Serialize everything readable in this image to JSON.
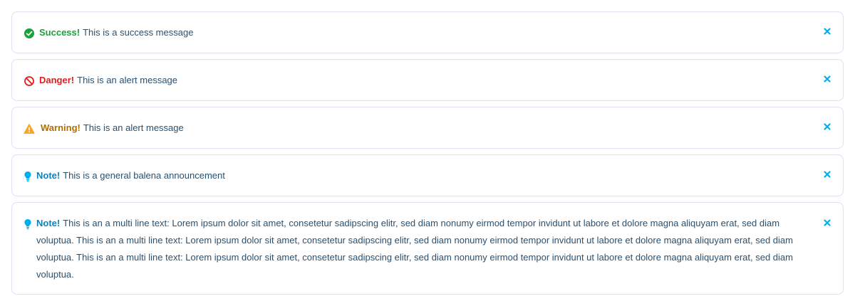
{
  "alerts": [
    {
      "type": "success",
      "icon": "check-circle-icon",
      "title": "Success!",
      "message": "This is a success message",
      "color": "#1aa13a"
    },
    {
      "type": "danger",
      "icon": "ban-icon",
      "title": "Danger!",
      "message": "This is an alert message",
      "color": "#e11d1d"
    },
    {
      "type": "warning",
      "icon": "warning-triangle-icon",
      "title": "Warning!",
      "message": "This is an alert message",
      "color": "#b06f00",
      "icon_color": "#f5a623"
    },
    {
      "type": "note",
      "icon": "lightbulb-icon",
      "title": "Note!",
      "message": "This is a general balena announcement",
      "color": "#0e82b6",
      "icon_color": "#00aeef"
    },
    {
      "type": "note",
      "icon": "lightbulb-icon",
      "title": "Note!",
      "message": "This is an a multi line text: Lorem ipsum dolor sit amet, consetetur sadipscing elitr, sed diam nonumy eirmod tempor invidunt ut labore et dolore magna aliquyam erat, sed diam voluptua. This is an a multi line text: Lorem ipsum dolor sit amet, consetetur sadipscing elitr, sed diam nonumy eirmod tempor invidunt ut labore et dolore magna aliquyam erat, sed diam voluptua. This is an a multi line text: Lorem ipsum dolor sit amet, consetetur sadipscing elitr, sed diam nonumy eirmod tempor invidunt ut labore et dolore magna aliquyam erat, sed diam voluptua.",
      "color": "#0e82b6",
      "icon_color": "#00aeef"
    }
  ],
  "close_icon": "close-icon",
  "close_color": "#00aeef",
  "text_color": "#2a506f",
  "border_color": "#dde1f0"
}
